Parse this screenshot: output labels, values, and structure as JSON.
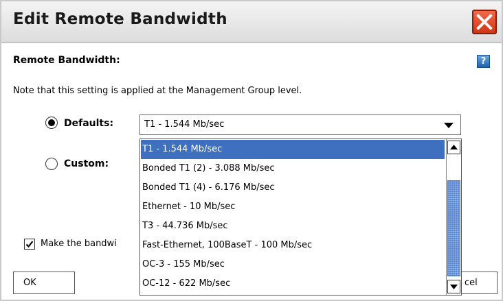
{
  "window": {
    "title": "Edit Remote Bandwidth"
  },
  "section": {
    "label": "Remote Bandwidth:",
    "help_glyph": "?"
  },
  "note": "Note that this setting is applied at the Management Group level.",
  "defaults": {
    "label": "Defaults:",
    "selected": true,
    "value": "T1 - 1.544 Mb/sec"
  },
  "custom": {
    "label": "Custom:",
    "selected": false
  },
  "dropdown": {
    "options": [
      "T1 - 1.544 Mb/sec",
      "Bonded T1 (2) - 3.088 Mb/sec",
      "Bonded T1 (4) - 6.176 Mb/sec",
      "Ethernet - 10 Mb/sec",
      "T3 - 44.736 Mb/sec",
      "Fast-Ethernet, 100BaseT - 100 Mb/sec",
      "OC-3 - 155 Mb/sec",
      "OC-12 - 622 Mb/sec"
    ],
    "selected_index": 0
  },
  "make_default": {
    "label": "Make the bandwi",
    "checked": true
  },
  "buttons": {
    "ok": "OK",
    "cancel_visible": "cel"
  },
  "colors": {
    "highlight": "#3f6fbf",
    "close": "#d9441f"
  }
}
